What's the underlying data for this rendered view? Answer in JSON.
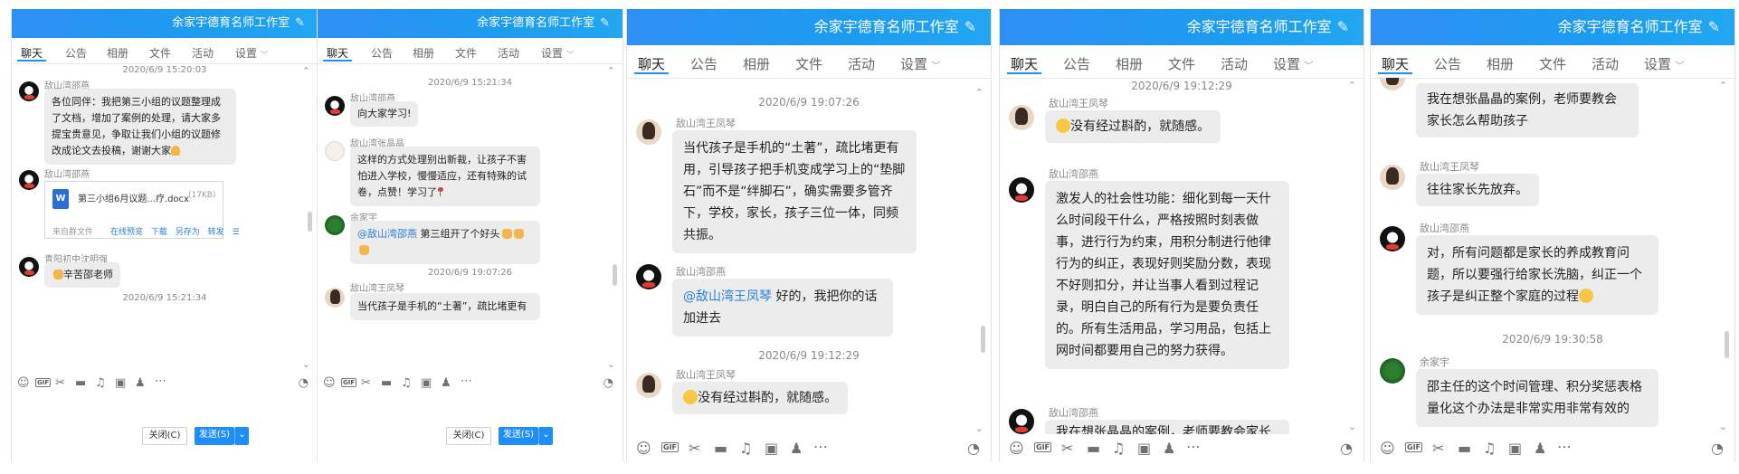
{
  "group_title": "余家宇德育名师工作室",
  "tabs": [
    "聊天",
    "公告",
    "相册",
    "文件",
    "活动",
    "设置"
  ],
  "panels": [
    {
      "timestamps": [
        "2020/6/9 15:20:03",
        "2020/6/9 15:21:34"
      ],
      "messages": [
        {
          "sender": "敌山湾邵燕",
          "text": "各位同伴：我把第三小组的议题整理成了文档，增加了案例的处理，请大家多提宝贵意见，争取让我们小组的议题修改成论文去投稿，谢谢大家"
        },
        {
          "sender": "敌山湾邵燕"
        },
        {
          "sender": "青阳初中沈明强",
          "text": "辛苦邵老师"
        }
      ],
      "file": {
        "name": "第三小组6月议题...疗.docx",
        "size": "(17KB)",
        "source": "来自群文件",
        "actions": [
          "在线预览",
          "下载",
          "另存为",
          "转发"
        ]
      },
      "buttons": {
        "close": "关闭(C)",
        "send": "发送(S)"
      }
    },
    {
      "timestamps": [
        "2020/6/9 15:21:34",
        "2020/6/9 19:07:26"
      ],
      "messages": [
        {
          "sender": "敌山湾邵燕",
          "text": "向大家学习!"
        },
        {
          "sender": "敌山湾张晶晶",
          "text": "这样的方式处理别出新裁，让孩子不害怕进入学校，慢慢适应，还有特殊的试卷，点赞！学习了"
        },
        {
          "sender": "余家宇",
          "mention": "@敌山湾邵燕",
          "text": " 第三组开了个好头"
        },
        {
          "sender": "敌山湾王凤琴",
          "text": "当代孩子是手机的“土著”，疏比堵更有"
        }
      ],
      "buttons": {
        "close": "关闭(C)",
        "send": "发送(S)"
      }
    },
    {
      "timestamps": [
        "2020/6/9 19:07:26",
        "2020/6/9 19:12:29"
      ],
      "messages": [
        {
          "sender": "敌山湾王凤琴",
          "text": "当代孩子是手机的“土著”，疏比堵更有用，引导孩子把手机变成学习上的“垫脚石”而不是“绊脚石”，确实需要多管齐下，学校，家长，孩子三位一体，同频共振。"
        },
        {
          "sender": "敌山湾邵燕",
          "mention": "@敌山湾王凤琴",
          "text": " 好的，我把你的话加进去"
        },
        {
          "sender": "敌山湾王凤琴",
          "text": "没有经过斟酌，就随感。"
        }
      ]
    },
    {
      "timestamps": [
        "2020/6/9 19:12:29"
      ],
      "messages": [
        {
          "sender": "敌山湾王凤琴",
          "text": "没有经过斟酌，就随感。"
        },
        {
          "sender": "敌山湾邵燕",
          "text": "激发人的社会性功能：细化到每一天什么时间段干什么，严格按照时刻表做事，进行行为约束，用积分制进行他律行为的纠正，表现好则奖励分数，表现不好则扣分，并让当事人看到过程记录，明白自己的所有行为是要负责任的。所有生活用品，学习用品，包括上网时间都要用自己的努力获得。"
        },
        {
          "sender": "敌山湾邵燕",
          "text": "我在想张晶晶的案例，老师要教会家长怎"
        }
      ]
    },
    {
      "timestamps": [
        "2020/6/9 19:30:58"
      ],
      "messages": [
        {
          "text": "我在想张晶晶的案例，老师要教会家长怎么帮助孩子"
        },
        {
          "sender": "敌山湾王凤琴",
          "text": "往往家长先放弃。"
        },
        {
          "sender": "敌山湾邵燕",
          "text": "对，所有问题都是家长的养成教育问题，所以要强行给家长洗脑，纠正一个孩子是纠正整个家庭的过程"
        },
        {
          "sender": "余家宇",
          "text": "邵主任的这个时间管理、积分奖惩表格量化这个办法是非常实用非常有效的"
        }
      ]
    }
  ]
}
